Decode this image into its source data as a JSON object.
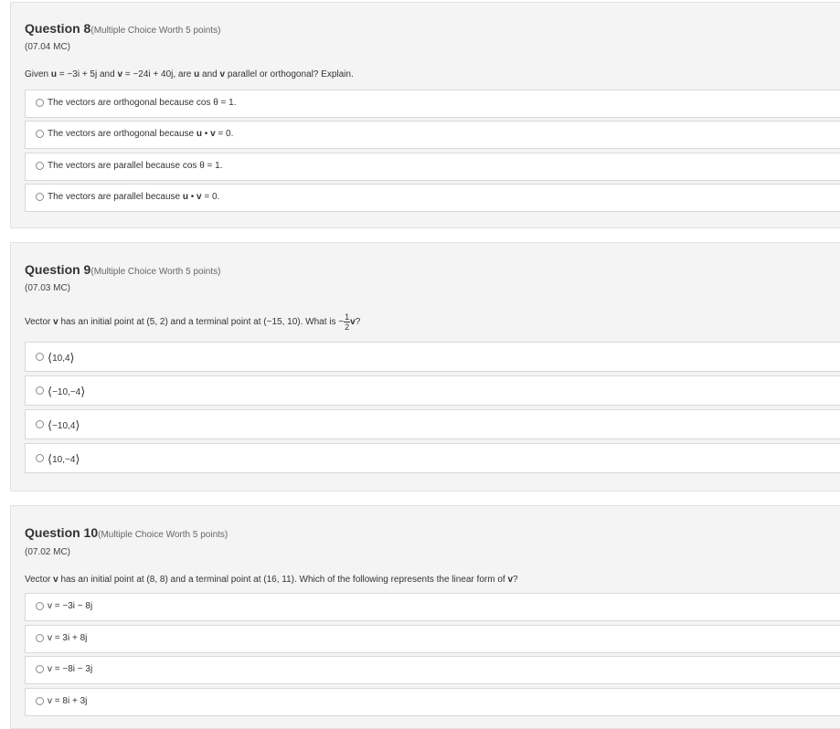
{
  "questions": [
    {
      "title": "Question 8",
      "worth": "(Multiple Choice Worth 5 points)",
      "code": "(07.04 MC)",
      "prompt": {
        "p1": "Given ",
        "u": "u",
        "p2": " = −3i + 5j and ",
        "v": "v",
        "p3": " = −24i + 40j, are ",
        "u2": "u",
        "p4": " and ",
        "v2": "v",
        "p5": " parallel or orthogonal? Explain."
      },
      "options": [
        {
          "text": "The vectors are orthogonal because cos θ = 1."
        },
        {
          "pre": "The vectors are orthogonal because ",
          "u": "u",
          "mid": " • ",
          "v": "v",
          "post": " = 0."
        },
        {
          "text": "The vectors are parallel because cos θ = 1."
        },
        {
          "pre": "The vectors are parallel because ",
          "u": "u",
          "mid": " • ",
          "v": "v",
          "post": " = 0."
        }
      ]
    },
    {
      "title": "Question 9",
      "worth": "(Multiple Choice Worth 5 points)",
      "code": "(07.03 MC)",
      "prompt": {
        "p1": "Vector ",
        "v": "v",
        "p2": " has an initial point at (5, 2) and a terminal point at (−15, 10). What is −",
        "num": "1",
        "den": "2",
        "v2": "v",
        "p3": "?"
      },
      "options": [
        {
          "open": "⟨",
          "text": "10,4",
          "close": "⟩"
        },
        {
          "open": "⟨",
          "text": "−10,−4",
          "close": "⟩"
        },
        {
          "open": "⟨",
          "text": "−10,4",
          "close": "⟩"
        },
        {
          "open": "⟨",
          "text": "10,−4",
          "close": "⟩"
        }
      ]
    },
    {
      "title": "Question 10",
      "worth": "(Multiple Choice Worth 5 points)",
      "code": "(07.02 MC)",
      "prompt": {
        "p1": "Vector ",
        "v": "v",
        "p2": " has an initial point at (8, 8) and a terminal point at (16, 11). Which of the following represents the linear form of ",
        "v2": "v",
        "p3": "?"
      },
      "options": [
        {
          "text": "v = −3i − 8j"
        },
        {
          "text": "v = 3i + 8j"
        },
        {
          "text": "v = −8i − 3j"
        },
        {
          "text": "v = 8i + 3j"
        }
      ]
    }
  ]
}
